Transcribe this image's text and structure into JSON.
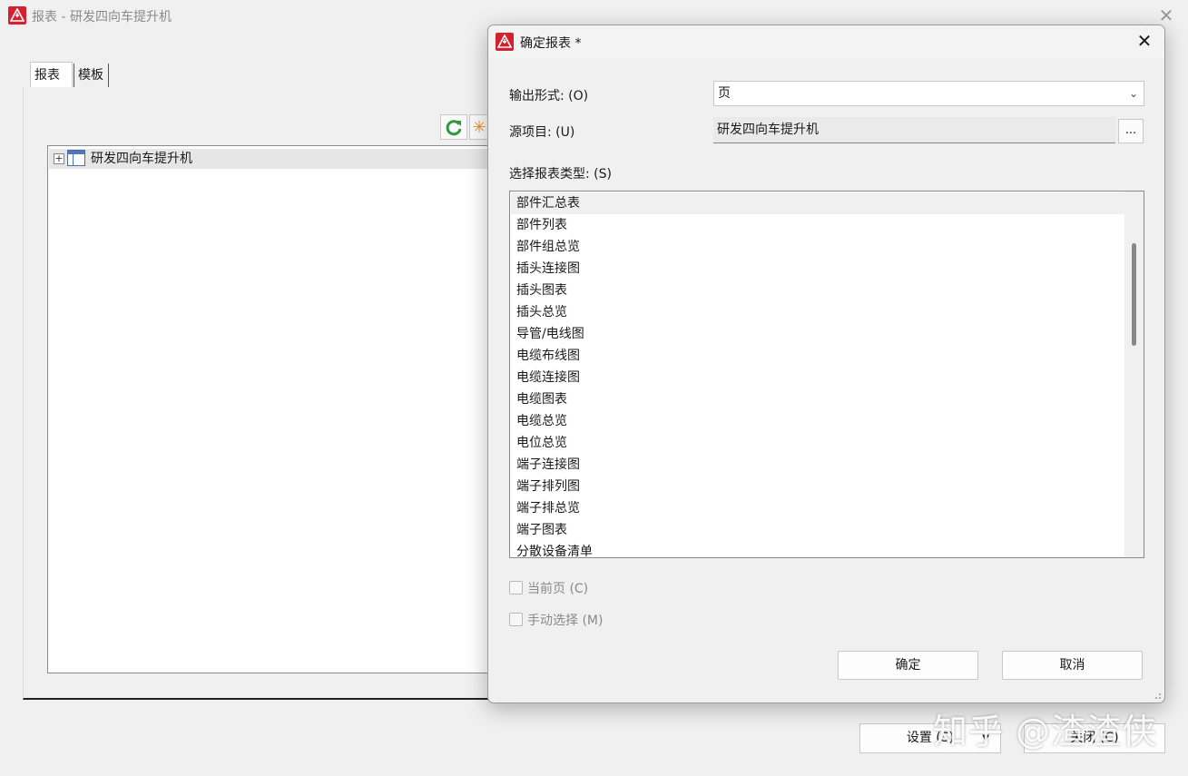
{
  "main_window": {
    "title": "报表 - 研发四向车提升机",
    "close_glyph": "✕",
    "tabs": [
      {
        "label": "报表",
        "active": true
      },
      {
        "label": "模板",
        "active": false
      }
    ],
    "toolbar": {
      "refresh_icon": "refresh-icon",
      "star_glyph": "✳"
    },
    "tree": {
      "expand_glyph": "+",
      "root_label": "研发四向车提升机"
    },
    "buttons": {
      "settings_label": "设置 (S)",
      "settings_caret": "▼",
      "close_label": "关闭 (C)"
    }
  },
  "dialog": {
    "title": "确定报表 *",
    "close_glyph": "✕",
    "output_form": {
      "label": "输出形式: (O)",
      "value": "页",
      "chevron": "⌄"
    },
    "source_project": {
      "label": "源项目: (U)",
      "value": "研发四向车提升机",
      "browse_label": "..."
    },
    "report_type": {
      "label": "选择报表类型: (S)",
      "items": [
        "部件汇总表",
        "部件列表",
        "部件组总览",
        "插头连接图",
        "插头图表",
        "插头总览",
        "导管/电线图",
        "电缆布线图",
        "电缆连接图",
        "电缆图表",
        "电缆总览",
        "电位总览",
        "端子连接图",
        "端子排列图",
        "端子排总览",
        "端子图表",
        "分散设备清单"
      ],
      "selected_index": 0
    },
    "checkboxes": {
      "current_page": {
        "label": "当前页 (C)",
        "checked": false,
        "enabled": false
      },
      "manual_select": {
        "label": "手动选择 (M)",
        "checked": false,
        "enabled": false
      }
    },
    "ok_label": "确定",
    "cancel_label": "取消"
  },
  "watermark": "知乎 @渣渣侠",
  "colors": {
    "brand_red": "#d5202e",
    "refresh_green": "#2e9a3e",
    "star_orange": "#e8902a",
    "window_bg": "#f0f0f0"
  }
}
